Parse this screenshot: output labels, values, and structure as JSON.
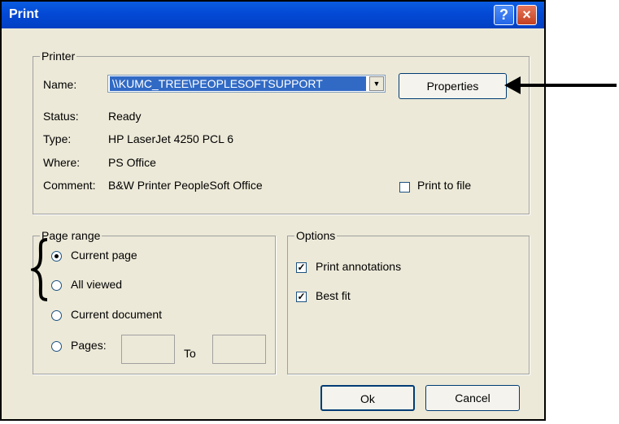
{
  "dialog": {
    "title": "Print"
  },
  "titlebar": {
    "help_icon": "?",
    "close_icon": "×"
  },
  "printer": {
    "legend": "Printer",
    "name_label": "Name:",
    "name_value": "\\\\KUMC_TREE\\PEOPLESOFTSUPPORT",
    "properties_label": "Properties",
    "status_label": "Status:",
    "status_value": "Ready",
    "type_label": "Type:",
    "type_value": "HP LaserJet 4250 PCL 6",
    "where_label": "Where:",
    "where_value": "PS Office",
    "comment_label": "Comment:",
    "comment_value": "B&W Printer PeopleSoft Office",
    "print_to_file_label": "Print to file",
    "print_to_file_checked": false
  },
  "page_range": {
    "legend": "Page range",
    "options": [
      "Current page",
      "All viewed",
      "Current document",
      "Pages:"
    ],
    "selected": "Current page",
    "to_label": "To"
  },
  "options": {
    "legend": "Options",
    "print_annotations_label": "Print annotations",
    "print_annotations_checked": true,
    "best_fit_label": "Best fit",
    "best_fit_checked": true
  },
  "buttons": {
    "ok": "Ok",
    "cancel": "Cancel"
  }
}
